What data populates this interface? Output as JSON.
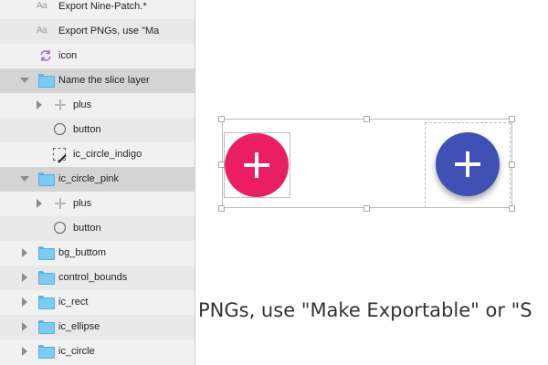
{
  "layers": [
    {
      "label": "Export Nine-Patch.*",
      "icon": "text-icon",
      "icon_text": "Aa",
      "level": 1,
      "arrow": "none"
    },
    {
      "label": "Export PNGs, use \"Ma",
      "icon": "text-icon",
      "icon_text": "Aa",
      "level": 1,
      "arrow": "none"
    },
    {
      "label": "icon",
      "icon": "symbol-icon",
      "icon_text": "",
      "level": 1,
      "arrow": "none"
    },
    {
      "label": "Name the slice layer",
      "icon": "folder-icon",
      "icon_text": "",
      "level": 0,
      "arrow": "down"
    },
    {
      "label": "plus",
      "icon": "plus-shape-icon",
      "icon_text": "",
      "level": 1,
      "arrow": "right"
    },
    {
      "label": "button",
      "icon": "oval-icon",
      "icon_text": "",
      "level": 1,
      "arrow": "none"
    },
    {
      "label": "ic_circle_indigo",
      "icon": "slice-icon",
      "icon_text": "",
      "level": 1,
      "arrow": "none"
    },
    {
      "label": "ic_circle_pink",
      "icon": "folder-open-icon",
      "icon_text": "",
      "level": 0,
      "arrow": "down"
    },
    {
      "label": "plus",
      "icon": "plus-shape-icon",
      "icon_text": "",
      "level": 1,
      "arrow": "right"
    },
    {
      "label": "button",
      "icon": "oval-icon",
      "icon_text": "",
      "level": 1,
      "arrow": "none"
    },
    {
      "label": "bg_buttom",
      "icon": "folder-icon",
      "icon_text": "",
      "level": 0,
      "arrow": "right"
    },
    {
      "label": "control_bounds",
      "icon": "folder-icon",
      "icon_text": "",
      "level": 0,
      "arrow": "right"
    },
    {
      "label": "ic_rect",
      "icon": "folder-icon",
      "icon_text": "",
      "level": 0,
      "arrow": "right"
    },
    {
      "label": "ic_ellipse",
      "icon": "folder-icon",
      "icon_text": "",
      "level": 0,
      "arrow": "right"
    },
    {
      "label": "ic_circle",
      "icon": "folder-icon",
      "icon_text": "",
      "level": 0,
      "arrow": "right"
    }
  ],
  "canvas": {
    "text": "PNGs, use \"Make Exportable\" or \"S",
    "buttons": [
      {
        "name": "pink-circle-button",
        "color": "#e91e63"
      },
      {
        "name": "indigo-circle-button",
        "color": "#3f51b5"
      }
    ]
  },
  "colors": {
    "panel_bg": "#f1f1f1",
    "selected_group_bg": "#d4d4d4",
    "folder": "#7dcaf3",
    "symbol": "#b05bd6"
  }
}
